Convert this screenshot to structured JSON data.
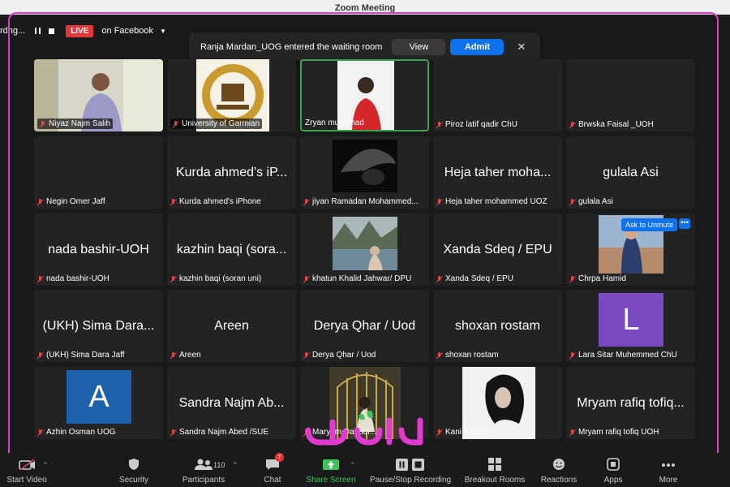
{
  "window": {
    "title": "Zoom Meeting"
  },
  "topbar": {
    "recording": "rdng...",
    "live": "LIVE",
    "facebook": "on Facebook"
  },
  "notification": {
    "text": "Ranja Mardan_UOG entered the waiting room",
    "view": "View",
    "admit": "Admit"
  },
  "participants": [
    {
      "name": "Niyaz Najm Salih",
      "big": "",
      "video": true
    },
    {
      "name": "University of Garmian",
      "big": "",
      "video": true
    },
    {
      "name": "Zryan muhamad",
      "big": "",
      "video": true
    },
    {
      "name": "Piroz latif qadir ChU",
      "big": ""
    },
    {
      "name": "Brwska Faisal _UOH",
      "big": ""
    },
    {
      "name": "Negin Omer Jaff",
      "big": ""
    },
    {
      "name": "Kurda ahmed's iPhone",
      "big": "Kurda ahmed's iP..."
    },
    {
      "name": "jiyan Ramadan Mohammed...",
      "big": "",
      "video": true
    },
    {
      "name": "Heja taher mohammed UOZ",
      "big": "Heja taher moha..."
    },
    {
      "name": "gulala Asi",
      "big": "gulala Asi"
    },
    {
      "name": "nada bashir-UOH",
      "big": "nada bashir-UOH"
    },
    {
      "name": "kazhin baqi (soran uni)",
      "big": "kazhin baqi (sora..."
    },
    {
      "name": "khatun Khalid Jahwar/ DPU",
      "big": "",
      "video": true
    },
    {
      "name": "Xanda Sdeq / EPU",
      "big": "Xanda Sdeq / EPU"
    },
    {
      "name": "Chrpa Hamid",
      "big": "",
      "video": true
    },
    {
      "name": "(UKH) Sima Dara Jaff",
      "big": "(UKH) Sima Dara..."
    },
    {
      "name": "Areen",
      "big": "Areen"
    },
    {
      "name": "Derya Qhar / Uod",
      "big": "Derya Qhar / Uod"
    },
    {
      "name": "shoxan rostam",
      "big": "shoxan rostam"
    },
    {
      "name": "Lara Sitar Muhemmed ChU",
      "big": "",
      "avatar": "L"
    },
    {
      "name": "Azhin Osman UOG",
      "big": "",
      "avatar": "A"
    },
    {
      "name": "Sandra Najm Abed /SUE",
      "big": "Sandra Najm Ab..."
    },
    {
      "name": "Maryam Daoudi...",
      "big": "",
      "video": true
    },
    {
      "name": "Kani Ibrahim",
      "big": "",
      "video": true
    },
    {
      "name": "Mryam rafiq tofiq UOH",
      "big": "Mryam rafiq tofiq..."
    }
  ],
  "tile_overlay": {
    "ask_unmute": "Ask to Unmute",
    "more": "•••"
  },
  "toolbar": {
    "start_video": "Start Video",
    "security": "Security",
    "participants": "Participants",
    "participants_count": "110",
    "chat": "Chat",
    "chat_badge": "7",
    "share_screen": "Share Screen",
    "pause_recording": "Pause/Stop Recording",
    "breakout": "Breakout Rooms",
    "reactions": "Reactions",
    "apps": "Apps",
    "more": "More"
  },
  "colors": {
    "accent_blue": "#0e72ed",
    "live_red": "#e7353a",
    "active_green": "#3aa54a",
    "frame_magenta": "#e03ad1",
    "share_green": "#3ec45a"
  }
}
